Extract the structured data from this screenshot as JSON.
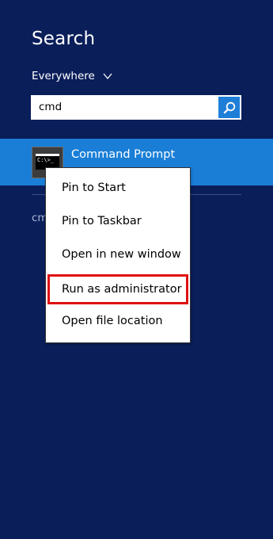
{
  "search": {
    "title": "Search",
    "scope_label": "Everywhere",
    "query": "cmd",
    "button_icon": "search-icon"
  },
  "result": {
    "label": "Command Prompt",
    "icon": "command-prompt-icon",
    "icon_text": "C:\\>_"
  },
  "partial_text": "cm",
  "context_menu": {
    "items": [
      {
        "label": "Pin to Start"
      },
      {
        "label": "Pin to Taskbar"
      },
      {
        "label": "Open in new window"
      },
      {
        "label": "Run as administrator",
        "highlighted": true
      },
      {
        "label": "Open file location"
      }
    ]
  },
  "colors": {
    "background": "#0a1e5a",
    "result_highlight": "#1a7ed7",
    "search_button": "#1f7fd8",
    "highlight_border": "#e01010"
  }
}
